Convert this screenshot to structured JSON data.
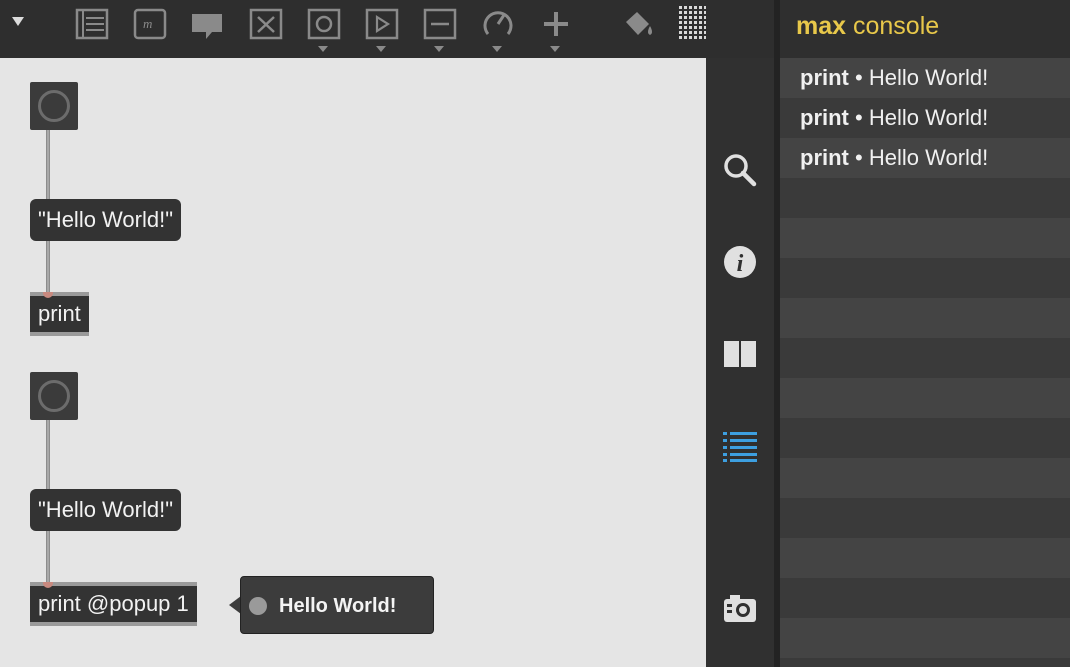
{
  "toolbar": {
    "items": [
      {
        "name": "menu-caret"
      },
      {
        "name": "comment-icon"
      },
      {
        "name": "message-icon"
      },
      {
        "name": "speech-bubble-icon"
      },
      {
        "name": "toggle-icon"
      },
      {
        "name": "button-icon"
      },
      {
        "name": "playbar-icon"
      },
      {
        "name": "slider-icon"
      },
      {
        "name": "dial-icon"
      },
      {
        "name": "add-object-icon"
      },
      {
        "name": "paint-bucket-icon"
      },
      {
        "name": "grid-icon"
      }
    ],
    "accent_color": "#e8c84a"
  },
  "patcher": {
    "group1": {
      "message_text": "\"Hello World!\"",
      "object_text": "print"
    },
    "group2": {
      "message_text": "\"Hello World!\"",
      "object_text": "print @popup 1",
      "popup_text": "Hello World!"
    }
  },
  "sidebar": {
    "items": [
      {
        "name": "search-icon"
      },
      {
        "name": "info-icon"
      },
      {
        "name": "reference-book-icon"
      },
      {
        "name": "console-list-icon",
        "active": true,
        "color": "#3d9fe0"
      },
      {
        "name": "snapshot-camera-icon"
      }
    ]
  },
  "console": {
    "title_bold": "max",
    "title_rest": "console",
    "messages": [
      {
        "source": "print",
        "separator": "•",
        "text": "Hello World!"
      },
      {
        "source": "print",
        "separator": "•",
        "text": "Hello World!"
      },
      {
        "source": "print",
        "separator": "•",
        "text": "Hello World!"
      }
    ]
  }
}
